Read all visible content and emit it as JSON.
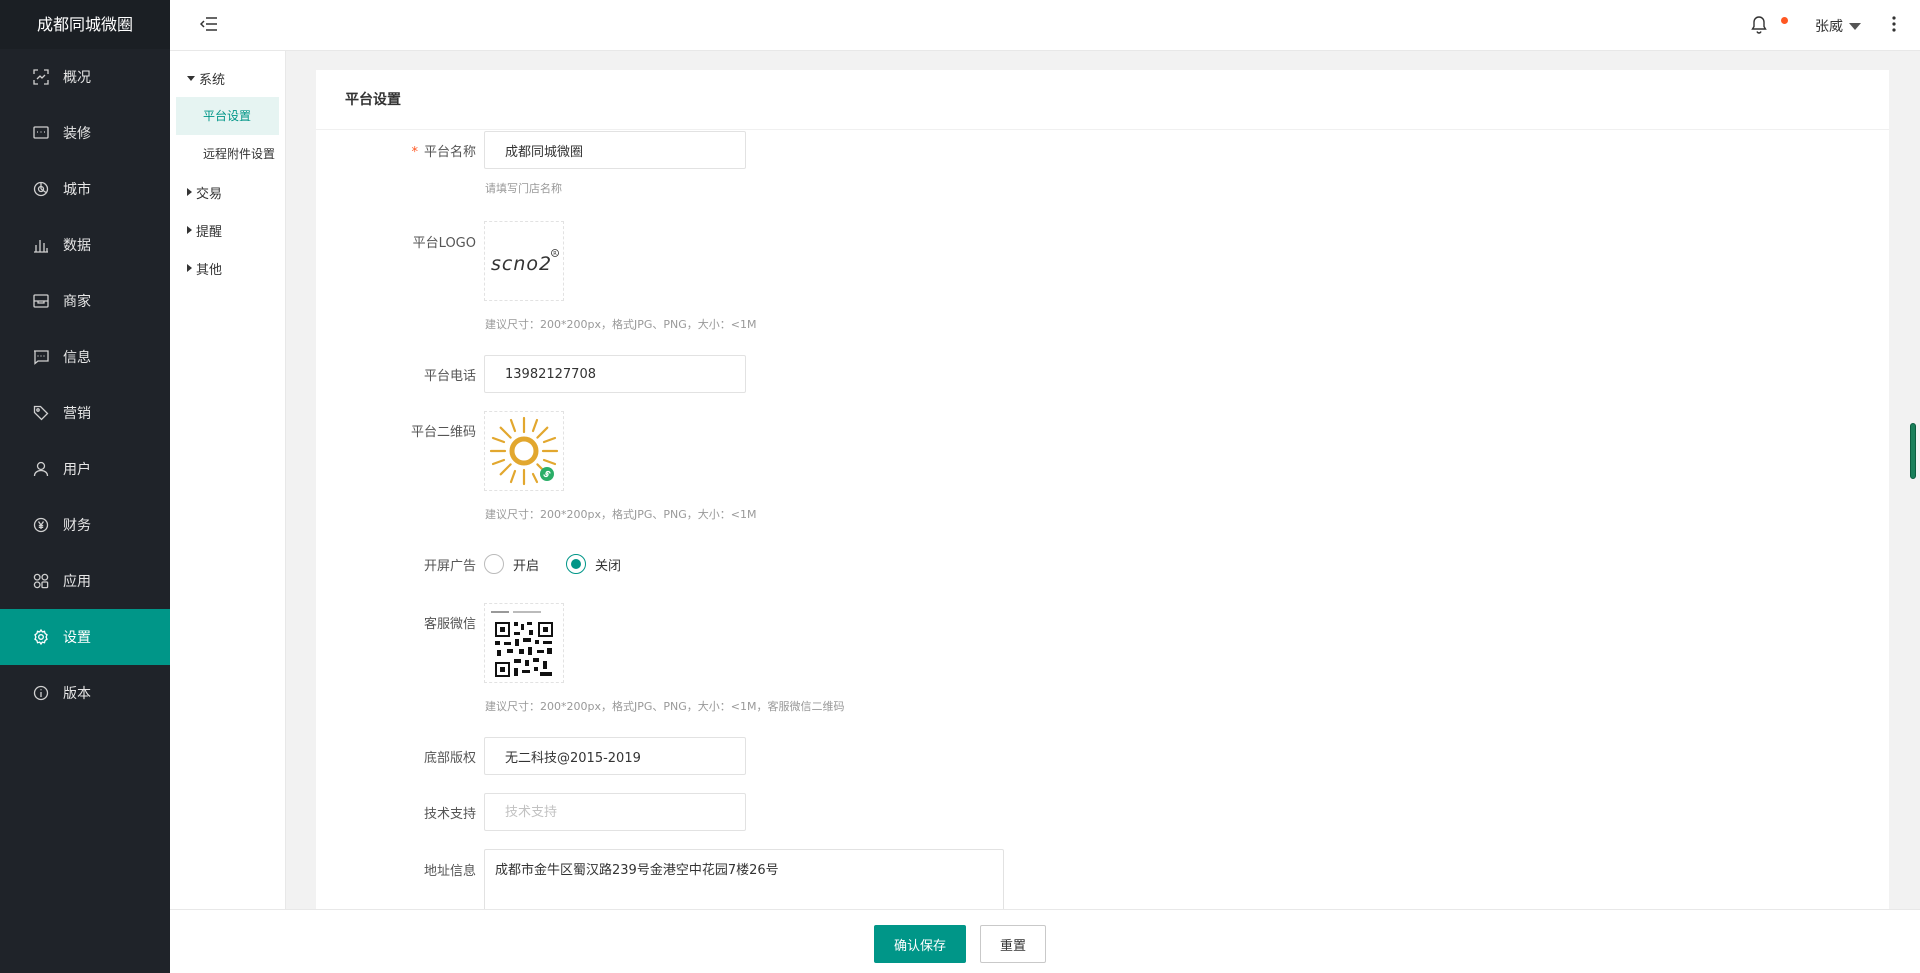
{
  "brand": "成都同城微圈",
  "nav": [
    {
      "label": "概况",
      "icon": "dashboard-icon"
    },
    {
      "label": "装修",
      "icon": "decorate-icon"
    },
    {
      "label": "城市",
      "icon": "city-icon"
    },
    {
      "label": "数据",
      "icon": "data-icon"
    },
    {
      "label": "商家",
      "icon": "store-icon"
    },
    {
      "label": "信息",
      "icon": "message-icon"
    },
    {
      "label": "营销",
      "icon": "tag-icon"
    },
    {
      "label": "用户",
      "icon": "user-icon"
    },
    {
      "label": "财务",
      "icon": "yen-icon"
    },
    {
      "label": "应用",
      "icon": "apps-icon"
    },
    {
      "label": "设置",
      "icon": "gear-icon",
      "active": true
    },
    {
      "label": "版本",
      "icon": "info-icon"
    }
  ],
  "topbar": {
    "user": "张威",
    "notification_dot_color": "#ff5722"
  },
  "submenu": {
    "groups": [
      {
        "label": "系统",
        "expanded": true
      },
      {
        "label": "交易",
        "expanded": false
      },
      {
        "label": "提醒",
        "expanded": false
      },
      {
        "label": "其他",
        "expanded": false
      }
    ],
    "items": [
      "平台设置",
      "远程附件设置"
    ]
  },
  "card": {
    "title": "平台设置"
  },
  "form": {
    "platform_name": {
      "label": "平台名称",
      "value": "成都同城微圈",
      "hint": "请填写门店名称",
      "required": "*"
    },
    "platform_logo": {
      "label": "平台LOGO",
      "hint": "建议尺寸：200*200px，格式JPG、PNG，大小：<1M"
    },
    "platform_phone": {
      "label": "平台电话",
      "value": "13982127708"
    },
    "platform_qrcode": {
      "label": "平台二维码",
      "hint": "建议尺寸：200*200px，格式JPG、PNG，大小：<1M"
    },
    "splash_ad": {
      "label": "开屏广告",
      "options": [
        "开启",
        "关闭"
      ],
      "selected": "关闭"
    },
    "service_wechat": {
      "label": "客服微信",
      "hint": "建议尺寸：200*200px，格式JPG、PNG，大小：<1M，客服微信二维码"
    },
    "copyright": {
      "label": "底部版权",
      "value": "无二科技@2015-2019"
    },
    "tech_support": {
      "label": "技术支持",
      "placeholder": "技术支持"
    },
    "address": {
      "label": "地址信息",
      "value": "成都市金牛区蜀汉路239号金港空中花园7楼26号"
    }
  },
  "actions": {
    "save": "确认保存",
    "reset": "重置"
  },
  "colors": {
    "primary": "#009688",
    "sidebar_bg": "#1f2329"
  }
}
